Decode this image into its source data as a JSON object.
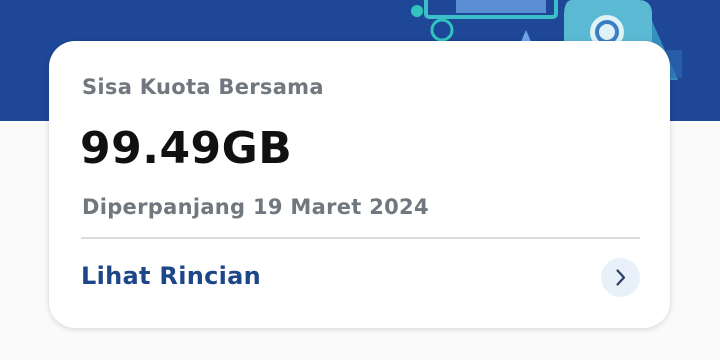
{
  "banner": {
    "background_color": "#1e4797",
    "decoration_icon": "mobile-device-illustration"
  },
  "quota_card": {
    "label": "Sisa Kuota Bersama",
    "value": "99.49GB",
    "renewal_text": "Diperpanjang 19 Maret 2024",
    "details_link": "Lihat Rincian",
    "details_icon": "chevron-right-icon"
  },
  "colors": {
    "accent": "#1c4688",
    "muted_text": "#70777f",
    "primary_text": "#111111"
  }
}
